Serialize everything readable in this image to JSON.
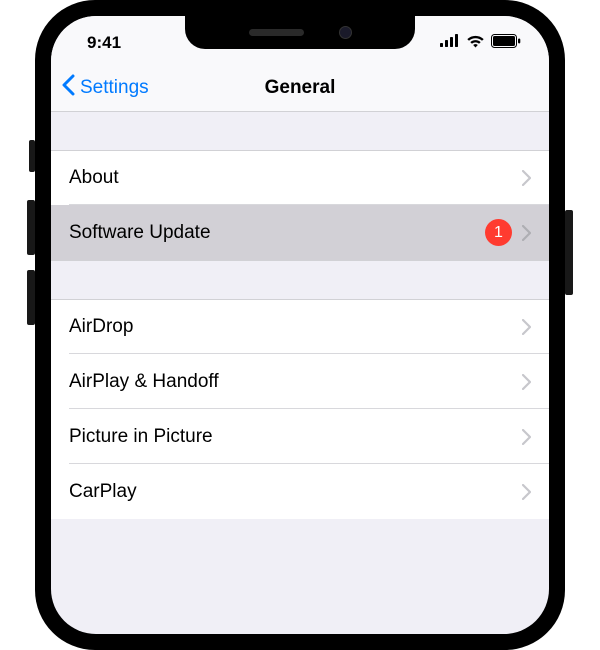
{
  "status": {
    "time": "9:41"
  },
  "nav": {
    "back_label": "Settings",
    "title": "General"
  },
  "rows": {
    "about": "About",
    "software_update": "Software Update",
    "software_update_badge": "1",
    "airdrop": "AirDrop",
    "airplay_handoff": "AirPlay & Handoff",
    "picture_in_picture": "Picture in Picture",
    "carplay": "CarPlay"
  },
  "colors": {
    "accent": "#007aff",
    "badge": "#ff3b30"
  }
}
